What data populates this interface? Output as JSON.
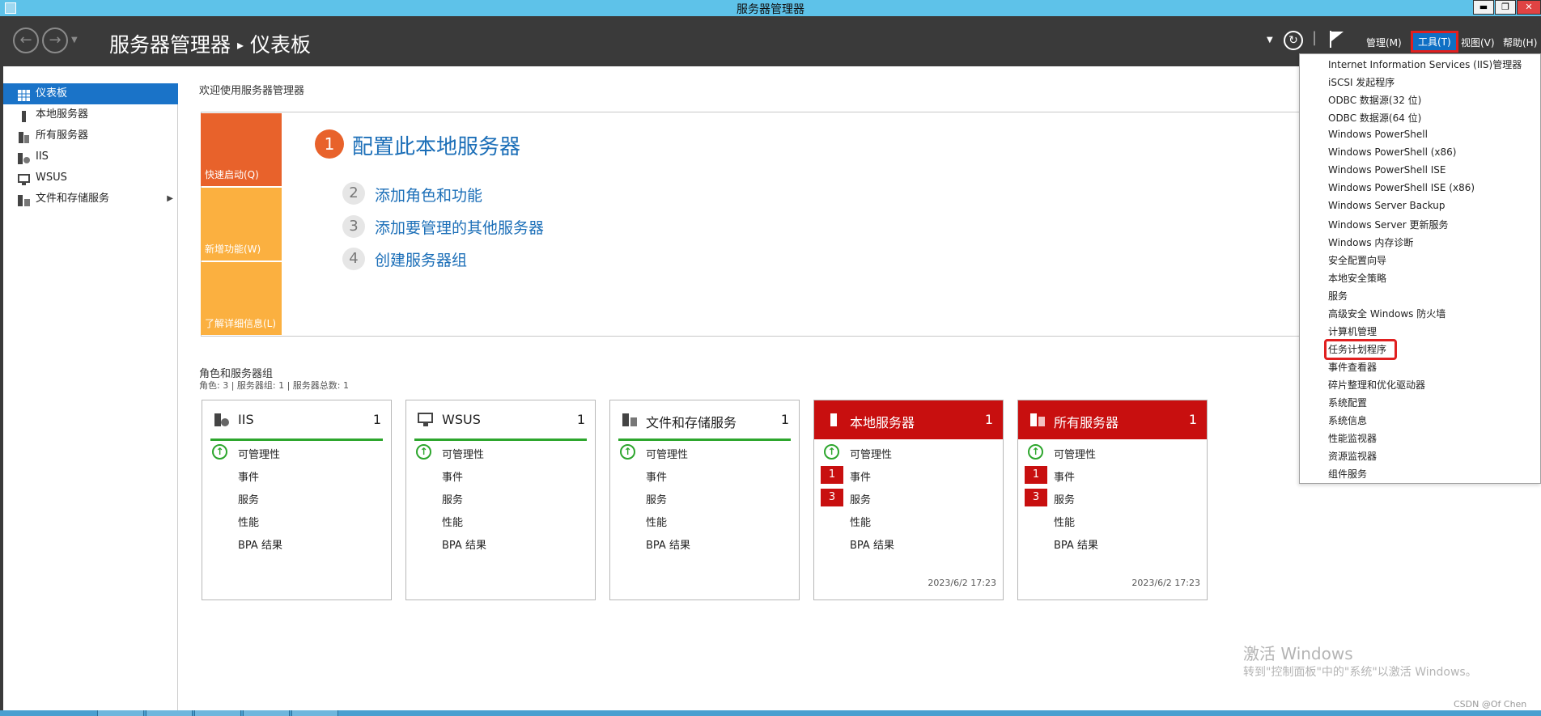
{
  "window": {
    "title": "服务器管理器",
    "minimize": "▬",
    "restore": "❐",
    "close": "✕"
  },
  "header": {
    "breadcrumb_root": "服务器管理器",
    "breadcrumb_sep": "▸",
    "breadcrumb_current": "仪表板",
    "menu_manage": "管理(M)",
    "menu_tools": "工具(T)",
    "menu_view": "视图(V)",
    "menu_help": "帮助(H)"
  },
  "sidebar": {
    "items": [
      {
        "label": "仪表板",
        "icon": "dashboard-icon",
        "active": true
      },
      {
        "label": "本地服务器",
        "icon": "server-icon"
      },
      {
        "label": "所有服务器",
        "icon": "servers-icon"
      },
      {
        "label": "IIS",
        "icon": "iis-icon"
      },
      {
        "label": "WSUS",
        "icon": "wsus-icon"
      },
      {
        "label": "文件和存储服务",
        "icon": "storage-icon"
      }
    ]
  },
  "welcome": {
    "title": "欢迎使用服务器管理器",
    "tiles": [
      "快速启动(Q)",
      "新增功能(W)",
      "了解详细信息(L)"
    ],
    "step1": {
      "num": "1",
      "label": "配置此本地服务器"
    },
    "steps": [
      {
        "num": "2",
        "label": "添加角色和功能"
      },
      {
        "num": "3",
        "label": "添加要管理的其他服务器"
      },
      {
        "num": "4",
        "label": "创建服务器组"
      }
    ]
  },
  "roles": {
    "title": "角色和服务器组",
    "subtitle": "角色: 3 | 服务器组: 1 | 服务器总数: 1",
    "cards": [
      {
        "name": "IIS",
        "count": "1",
        "rows": [
          "可管理性",
          "事件",
          "服务",
          "性能",
          "BPA 结果"
        ]
      },
      {
        "name": "WSUS",
        "count": "1",
        "rows": [
          "可管理性",
          "事件",
          "服务",
          "性能",
          "BPA 结果"
        ]
      },
      {
        "name": "文件和存储服务",
        "count": "1",
        "rows": [
          "可管理性",
          "事件",
          "服务",
          "性能",
          "BPA 结果"
        ]
      },
      {
        "name": "本地服务器",
        "count": "1",
        "rows": [
          "可管理性",
          "事件",
          "服务",
          "性能",
          "BPA 结果"
        ],
        "badges": [
          "1",
          "3"
        ],
        "date": "2023/6/2 17:23"
      },
      {
        "name": "所有服务器",
        "count": "1",
        "rows": [
          "可管理性",
          "事件",
          "服务",
          "性能",
          "BPA 结果"
        ],
        "badges": [
          "1",
          "3"
        ],
        "date": "2023/6/2 17:23"
      }
    ]
  },
  "tools_menu": {
    "items": [
      "Internet Information Services (IIS)管理器",
      "iSCSI 发起程序",
      "ODBC 数据源(32 位)",
      "ODBC 数据源(64 位)",
      "Windows PowerShell",
      "Windows PowerShell (x86)",
      "Windows PowerShell ISE",
      "Windows PowerShell ISE (x86)",
      "Windows Server Backup",
      "Windows Server 更新服务",
      "Windows 内存诊断",
      "安全配置向导",
      "本地安全策略",
      "服务",
      "高级安全 Windows 防火墙",
      "计算机管理",
      "任务计划程序",
      "事件查看器",
      "碎片整理和优化驱动器",
      "系统配置",
      "系统信息",
      "性能监视器",
      "资源监视器",
      "组件服务"
    ],
    "highlighted": "任务计划程序"
  },
  "watermark": {
    "title": "激活 Windows",
    "subtitle": "转到\"控制面板\"中的\"系统\"以激活 Windows。",
    "credit": "CSDN @Of Chen"
  },
  "colors": {
    "accent": "#1a73c8",
    "alert": "#c80f0f",
    "ok": "#2da62d",
    "orange": "#e8622b",
    "tile_light": "#fbb040"
  }
}
